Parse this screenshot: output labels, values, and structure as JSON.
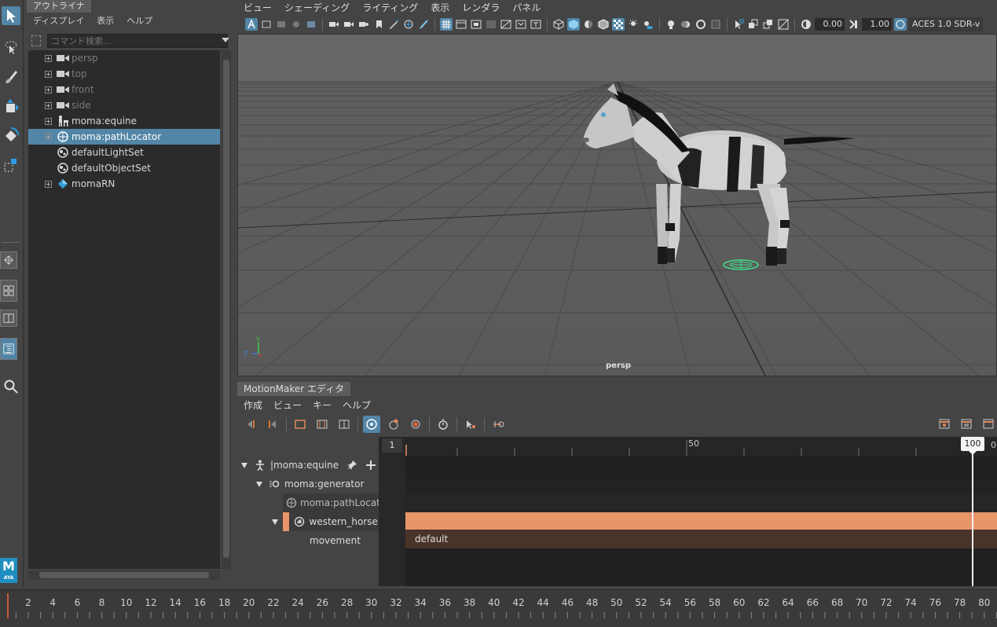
{
  "outliner": {
    "title": "アウトライナ",
    "menu": [
      "ディスプレイ",
      "表示",
      "ヘルプ"
    ],
    "search_placeholder": "コマンド検索...",
    "items": [
      {
        "label": "persp",
        "icon": "camera-icon",
        "dim": true,
        "expandable": true
      },
      {
        "label": "top",
        "icon": "camera-icon",
        "dim": true,
        "expandable": true
      },
      {
        "label": "front",
        "icon": "camera-icon",
        "dim": true,
        "expandable": true
      },
      {
        "label": "side",
        "icon": "camera-icon",
        "dim": true,
        "expandable": true
      },
      {
        "label": "moma:equine",
        "icon": "character-icon",
        "dim": false,
        "expandable": true
      },
      {
        "label": "moma:pathLocator",
        "icon": "locator-icon",
        "dim": false,
        "expandable": true,
        "selected": true
      },
      {
        "label": "defaultLightSet",
        "icon": "set-icon",
        "dim": false,
        "expandable": false
      },
      {
        "label": "defaultObjectSet",
        "icon": "set-icon",
        "dim": false,
        "expandable": false
      },
      {
        "label": "momaRN",
        "icon": "reference-icon",
        "dim": false,
        "expandable": true
      }
    ]
  },
  "viewport": {
    "menu": [
      "ビュー",
      "シェーディング",
      "ライティング",
      "表示",
      "レンダラ",
      "パネル"
    ],
    "exposure": "0.00",
    "gamma": "1.00",
    "color_space": "ACES 1.0 SDR-v",
    "camera_label": "persp",
    "axis_y": "Y",
    "axis_z": "Z"
  },
  "motionmaker": {
    "tab": "MotionMaker エディタ",
    "menu": [
      "作成",
      "ビュー",
      "キー",
      "ヘルプ"
    ],
    "start_frame": "1",
    "current_frame": "100",
    "ruler_label_mid": "50",
    "ruler_end_partial": "0",
    "tracks": {
      "equine": "|moma:equine",
      "generator": "moma:generator",
      "path_locator": "moma:pathLocato",
      "western_horse": "western_horse",
      "movement": "movement",
      "movement_clip": "default"
    },
    "colors": {
      "accent": "#5285a6",
      "clip": "#e8956a",
      "clip_dark": "#4a3328"
    }
  },
  "time_slider": {
    "labels": [
      "2",
      "4",
      "6",
      "8",
      "10",
      "12",
      "14",
      "16",
      "18",
      "20",
      "22",
      "24",
      "26",
      "28",
      "30",
      "32",
      "34",
      "36",
      "38",
      "40",
      "42",
      "44",
      "46",
      "48",
      "50",
      "52",
      "54",
      "56",
      "58",
      "60",
      "62",
      "64",
      "66",
      "68",
      "70",
      "72",
      "74",
      "76",
      "78",
      "80"
    ]
  },
  "toolbox": {
    "logo_text": "M",
    "logo_sub": "AYA"
  }
}
